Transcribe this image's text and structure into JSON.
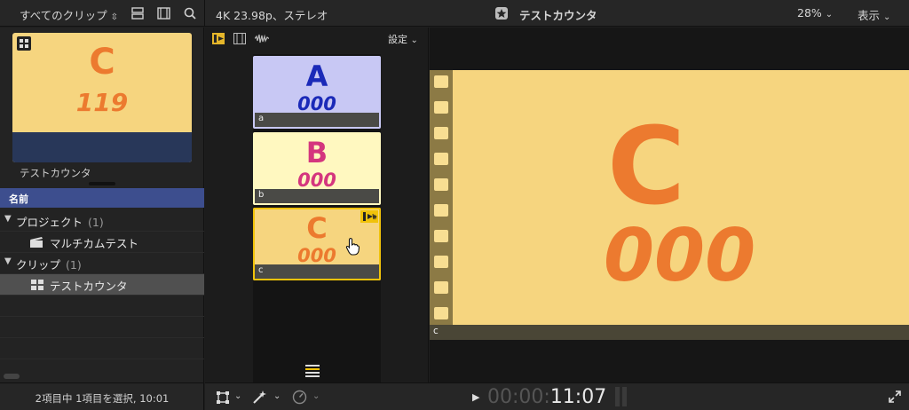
{
  "browser": {
    "filter_label": "すべてのクリップ",
    "clip_thumbnail": {
      "letter": "C",
      "number": "119",
      "name": "テストカウンタ"
    },
    "column_header": "名前",
    "rows": [
      {
        "kind": "group",
        "label": "プロジェクト",
        "count": "(1)"
      },
      {
        "kind": "item",
        "label": "マルチカムテスト",
        "icon": "clapper-icon"
      },
      {
        "kind": "group",
        "label": "クリップ",
        "count": "(1)"
      },
      {
        "kind": "item",
        "label": "テストカウンタ",
        "icon": "multicam-icon",
        "selected": true
      }
    ],
    "status": "2項目中 1項目を選択, 10:01"
  },
  "viewer_header": {
    "format": "4K 23.98p、ステレオ",
    "title": "テストカウンタ",
    "zoom": "28%",
    "view_menu": "表示"
  },
  "angle_viewer": {
    "settings_label": "設定",
    "angles": [
      {
        "letter": "A",
        "number": "000",
        "caption": "a",
        "bg": "#c8c8f4",
        "fg": "#1b2ab8",
        "active": false
      },
      {
        "letter": "B",
        "number": "000",
        "caption": "b",
        "bg": "#fff8c0",
        "fg": "#d4367e",
        "active": false
      },
      {
        "letter": "C",
        "number": "000",
        "caption": "c",
        "bg": "#f6d57f",
        "fg": "#ec7a2f",
        "active": true
      }
    ]
  },
  "viewer": {
    "letter": "C",
    "number": "000",
    "caption": "c"
  },
  "timecode": {
    "dim": "00:00:",
    "bright": "11:07"
  },
  "colors": {
    "accent": "#f0c20a",
    "selection": "#3d4e8e",
    "clip_orange": "#ec7a2f",
    "clip_yellow": "#f6d57f"
  }
}
